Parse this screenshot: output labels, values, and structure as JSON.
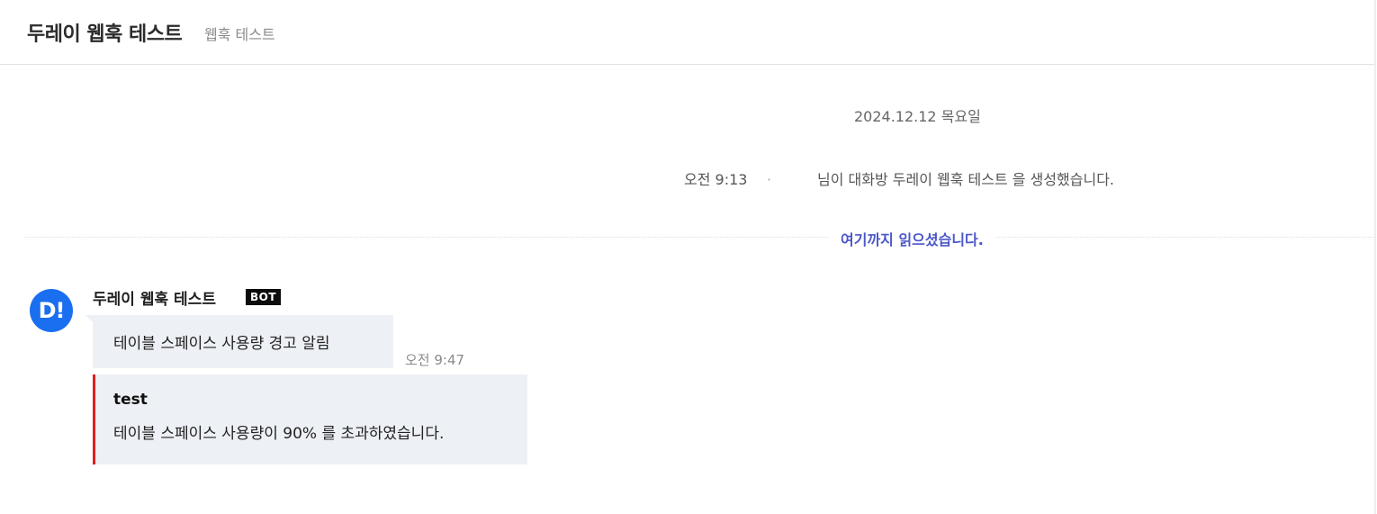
{
  "header": {
    "title": "두레이 웹훅 테스트",
    "subtitle": "웹훅 테스트"
  },
  "timeline": {
    "date_separator": "2024.12.12 목요일",
    "system_message": {
      "time": "오전 9:13",
      "dot": "·",
      "text": "님이 대화방 두레이 웹훅 테스트 을 생성했습니다."
    },
    "read_marker": "여기까지 읽으셨습니다."
  },
  "message": {
    "avatar_text": "D!",
    "sender": "두레이 웹훅 테스트",
    "badge": "BOT",
    "text": "테이블 스페이스 사용량 경고 알림",
    "time": "오전 9:47",
    "attachment": {
      "title": "test",
      "text": "테이블 스페이스 사용량이 90% 를 초과하였습니다.",
      "accent_color": "#e01e1e"
    }
  },
  "colors": {
    "avatar": "#1a6ff0",
    "read_marker": "#4b57c9",
    "bubble": "#edf0f4"
  }
}
